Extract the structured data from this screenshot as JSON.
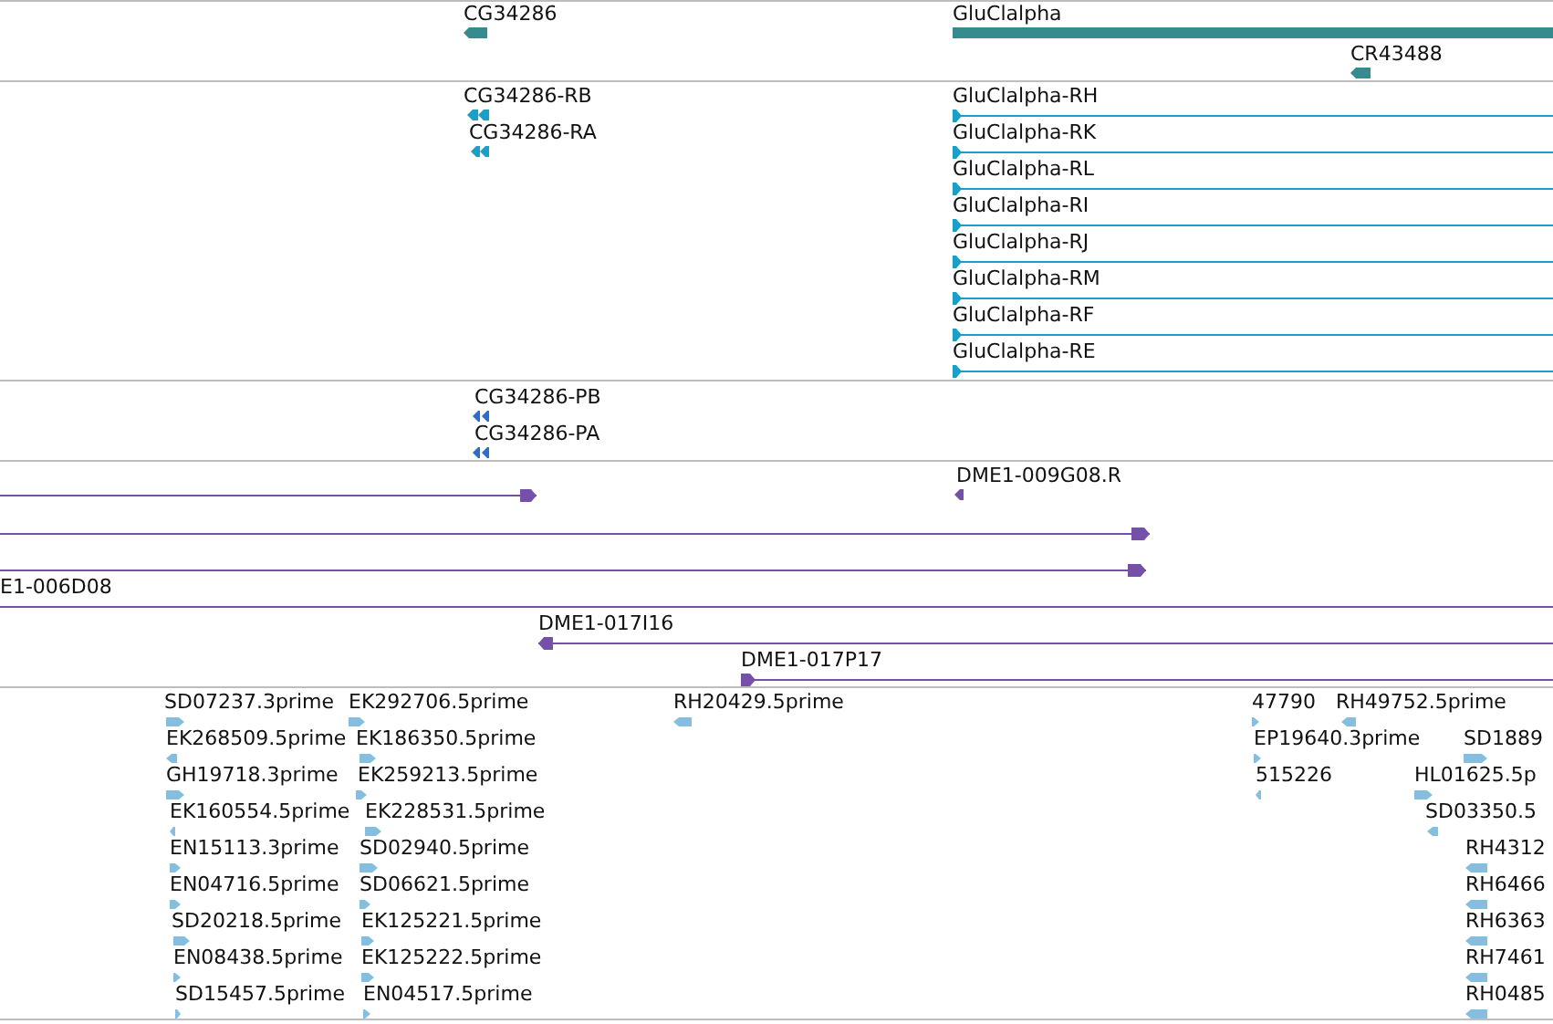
{
  "tracks": [
    {
      "kind": "gene",
      "features": [
        {
          "label": "CG34286",
          "reverse": true
        },
        {
          "label": "GluClalpha"
        },
        {
          "label": "CR43488",
          "reverse": true
        }
      ]
    },
    {
      "kind": "transcript",
      "features": [
        {
          "label": "CG34286-RB",
          "reverse": true
        },
        {
          "label": "CG34286-RA",
          "reverse": true
        },
        {
          "label": "GluClalpha-RH",
          "reverse": false
        },
        {
          "label": "GluClalpha-RK",
          "reverse": false
        },
        {
          "label": "GluClalpha-RL",
          "reverse": false
        },
        {
          "label": "GluClalpha-RI",
          "reverse": false
        },
        {
          "label": "GluClalpha-RJ",
          "reverse": false
        },
        {
          "label": "GluClalpha-RM",
          "reverse": false
        },
        {
          "label": "GluClalpha-RF",
          "reverse": false
        },
        {
          "label": "GluClalpha-RE",
          "reverse": false
        }
      ]
    },
    {
      "kind": "protein",
      "features": [
        {
          "label": "CG34286-PB",
          "reverse": true
        },
        {
          "label": "CG34286-PA",
          "reverse": true
        }
      ]
    },
    {
      "kind": "clone",
      "features": [
        {
          "reverse": false
        },
        {
          "label": "DME1-009G08.R",
          "reverse": true
        },
        {
          "reverse": false
        },
        {
          "reverse": false
        },
        {
          "label": "E1-006D08"
        },
        {
          "label": "DME1-017I16",
          "reverse": true
        },
        {
          "label": "DME1-017P17",
          "reverse": false
        }
      ]
    },
    {
      "kind": "est",
      "features": [
        {
          "label": "SD07237.3prime",
          "reverse": false
        },
        {
          "label": "EK268509.5prime",
          "reverse": true
        },
        {
          "label": "GH19718.3prime",
          "reverse": false
        },
        {
          "label": "EK160554.5prime",
          "reverse": true
        },
        {
          "label": "EN15113.3prime",
          "reverse": false
        },
        {
          "label": "EN04716.5prime",
          "reverse": false
        },
        {
          "label": "SD20218.5prime",
          "reverse": false
        },
        {
          "label": "EN08438.5prime",
          "reverse": false
        },
        {
          "label": "SD15457.5prime",
          "reverse": false
        },
        {
          "label": "EK292706.5prime",
          "reverse": false
        },
        {
          "label": "EK186350.5prime",
          "reverse": false
        },
        {
          "label": "EK259213.5prime",
          "reverse": false
        },
        {
          "label": "EK228531.5prime",
          "reverse": false
        },
        {
          "label": "SD02940.5prime",
          "reverse": false
        },
        {
          "label": "SD06621.5prime",
          "reverse": false
        },
        {
          "label": "EK125221.5prime",
          "reverse": false
        },
        {
          "label": "EK125222.5prime",
          "reverse": false
        },
        {
          "label": "EN04517.5prime",
          "reverse": false
        },
        {
          "label": "RH20429.5prime",
          "reverse": true
        },
        {
          "label": "47790",
          "reverse": false
        },
        {
          "label": "RH49752.5prime",
          "reverse": true
        },
        {
          "label": "EP19640.3prime",
          "reverse": false
        },
        {
          "label": "SD1889",
          "reverse": false
        },
        {
          "label": "515226",
          "reverse": true
        },
        {
          "label": "HL01625.5p",
          "reverse": false
        },
        {
          "label": "SD03350.5",
          "reverse": true
        },
        {
          "label": "RH4312",
          "reverse": true
        },
        {
          "label": "RH6466",
          "reverse": true
        },
        {
          "label": "RH6363",
          "reverse": true
        },
        {
          "label": "RH7461",
          "reverse": true
        },
        {
          "label": "RH0485",
          "reverse": true
        }
      ]
    }
  ]
}
